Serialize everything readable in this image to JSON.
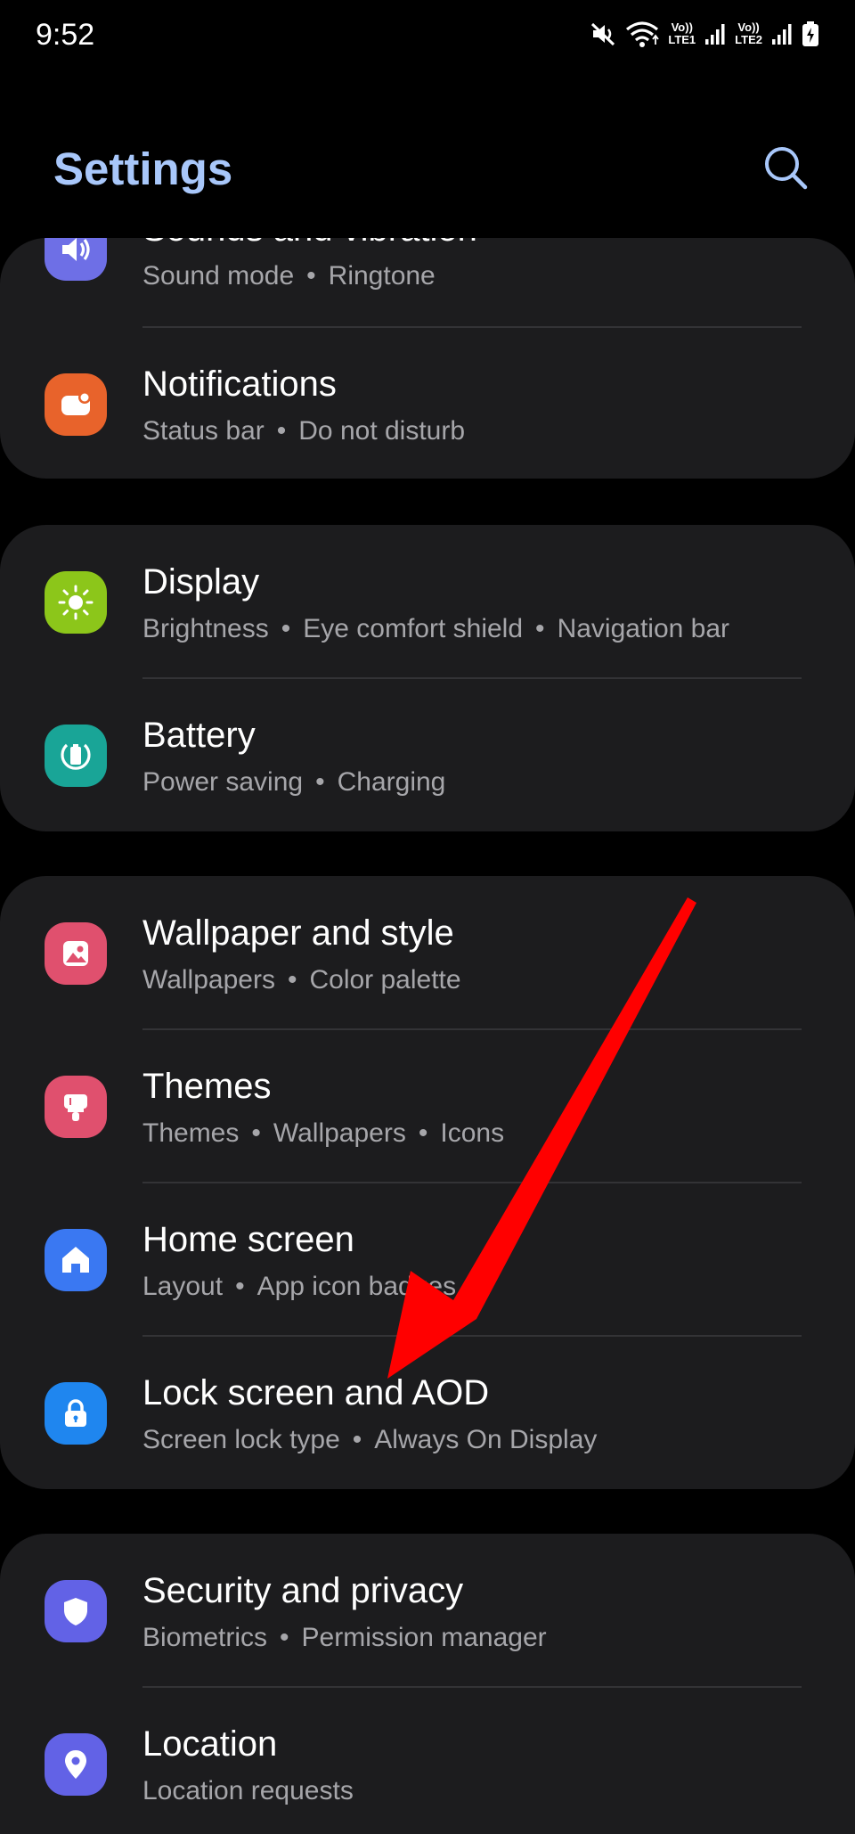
{
  "status_bar": {
    "time": "9:52",
    "sim1_label_top": "Vo))",
    "sim1_label_bottom": "LTE1",
    "sim2_label_top": "Vo))",
    "sim2_label_bottom": "LTE2",
    "icons": [
      "mute-icon",
      "wifi-icon",
      "signal-icon",
      "battery-charging-icon"
    ]
  },
  "header": {
    "title": "Settings",
    "search_icon": "search-icon"
  },
  "groups": [
    {
      "items": [
        {
          "title": "Sounds and vibration",
          "subtitle": [
            "Sound mode",
            "Ringtone"
          ],
          "icon": "volume-icon",
          "color": "#6e6fe6"
        },
        {
          "title": "Notifications",
          "subtitle": [
            "Status bar",
            "Do not disturb"
          ],
          "icon": "notification-icon",
          "color": "#e8632b"
        }
      ]
    },
    {
      "items": [
        {
          "title": "Display",
          "subtitle": [
            "Brightness",
            "Eye comfort shield",
            "Navigation bar"
          ],
          "icon": "sun-icon",
          "color": "#8cc61a"
        },
        {
          "title": "Battery",
          "subtitle": [
            "Power saving",
            "Charging"
          ],
          "icon": "battery-icon",
          "color": "#19a597"
        }
      ]
    },
    {
      "items": [
        {
          "title": "Wallpaper and style",
          "subtitle": [
            "Wallpapers",
            "Color palette"
          ],
          "icon": "image-icon",
          "color": "#e0506e"
        },
        {
          "title": "Themes",
          "subtitle": [
            "Themes",
            "Wallpapers",
            "Icons"
          ],
          "icon": "paintbrush-icon",
          "color": "#e0506e"
        },
        {
          "title": "Home screen",
          "subtitle": [
            "Layout",
            "App icon badges"
          ],
          "icon": "home-icon",
          "color": "#3a78f2"
        },
        {
          "title": "Lock screen and AOD",
          "subtitle": [
            "Screen lock type",
            "Always On Display"
          ],
          "icon": "lock-icon",
          "color": "#1f86ef"
        }
      ]
    },
    {
      "items": [
        {
          "title": "Security and privacy",
          "subtitle": [
            "Biometrics",
            "Permission manager"
          ],
          "icon": "shield-icon",
          "color": "#6262e6"
        },
        {
          "title": "Location",
          "subtitle": [
            "Location requests"
          ],
          "icon": "location-pin-icon",
          "color": "#6262e6"
        }
      ]
    }
  ],
  "annotation": {
    "arrow_color": "#ff0000",
    "arrow_icon": "red-arrow-annotation"
  }
}
